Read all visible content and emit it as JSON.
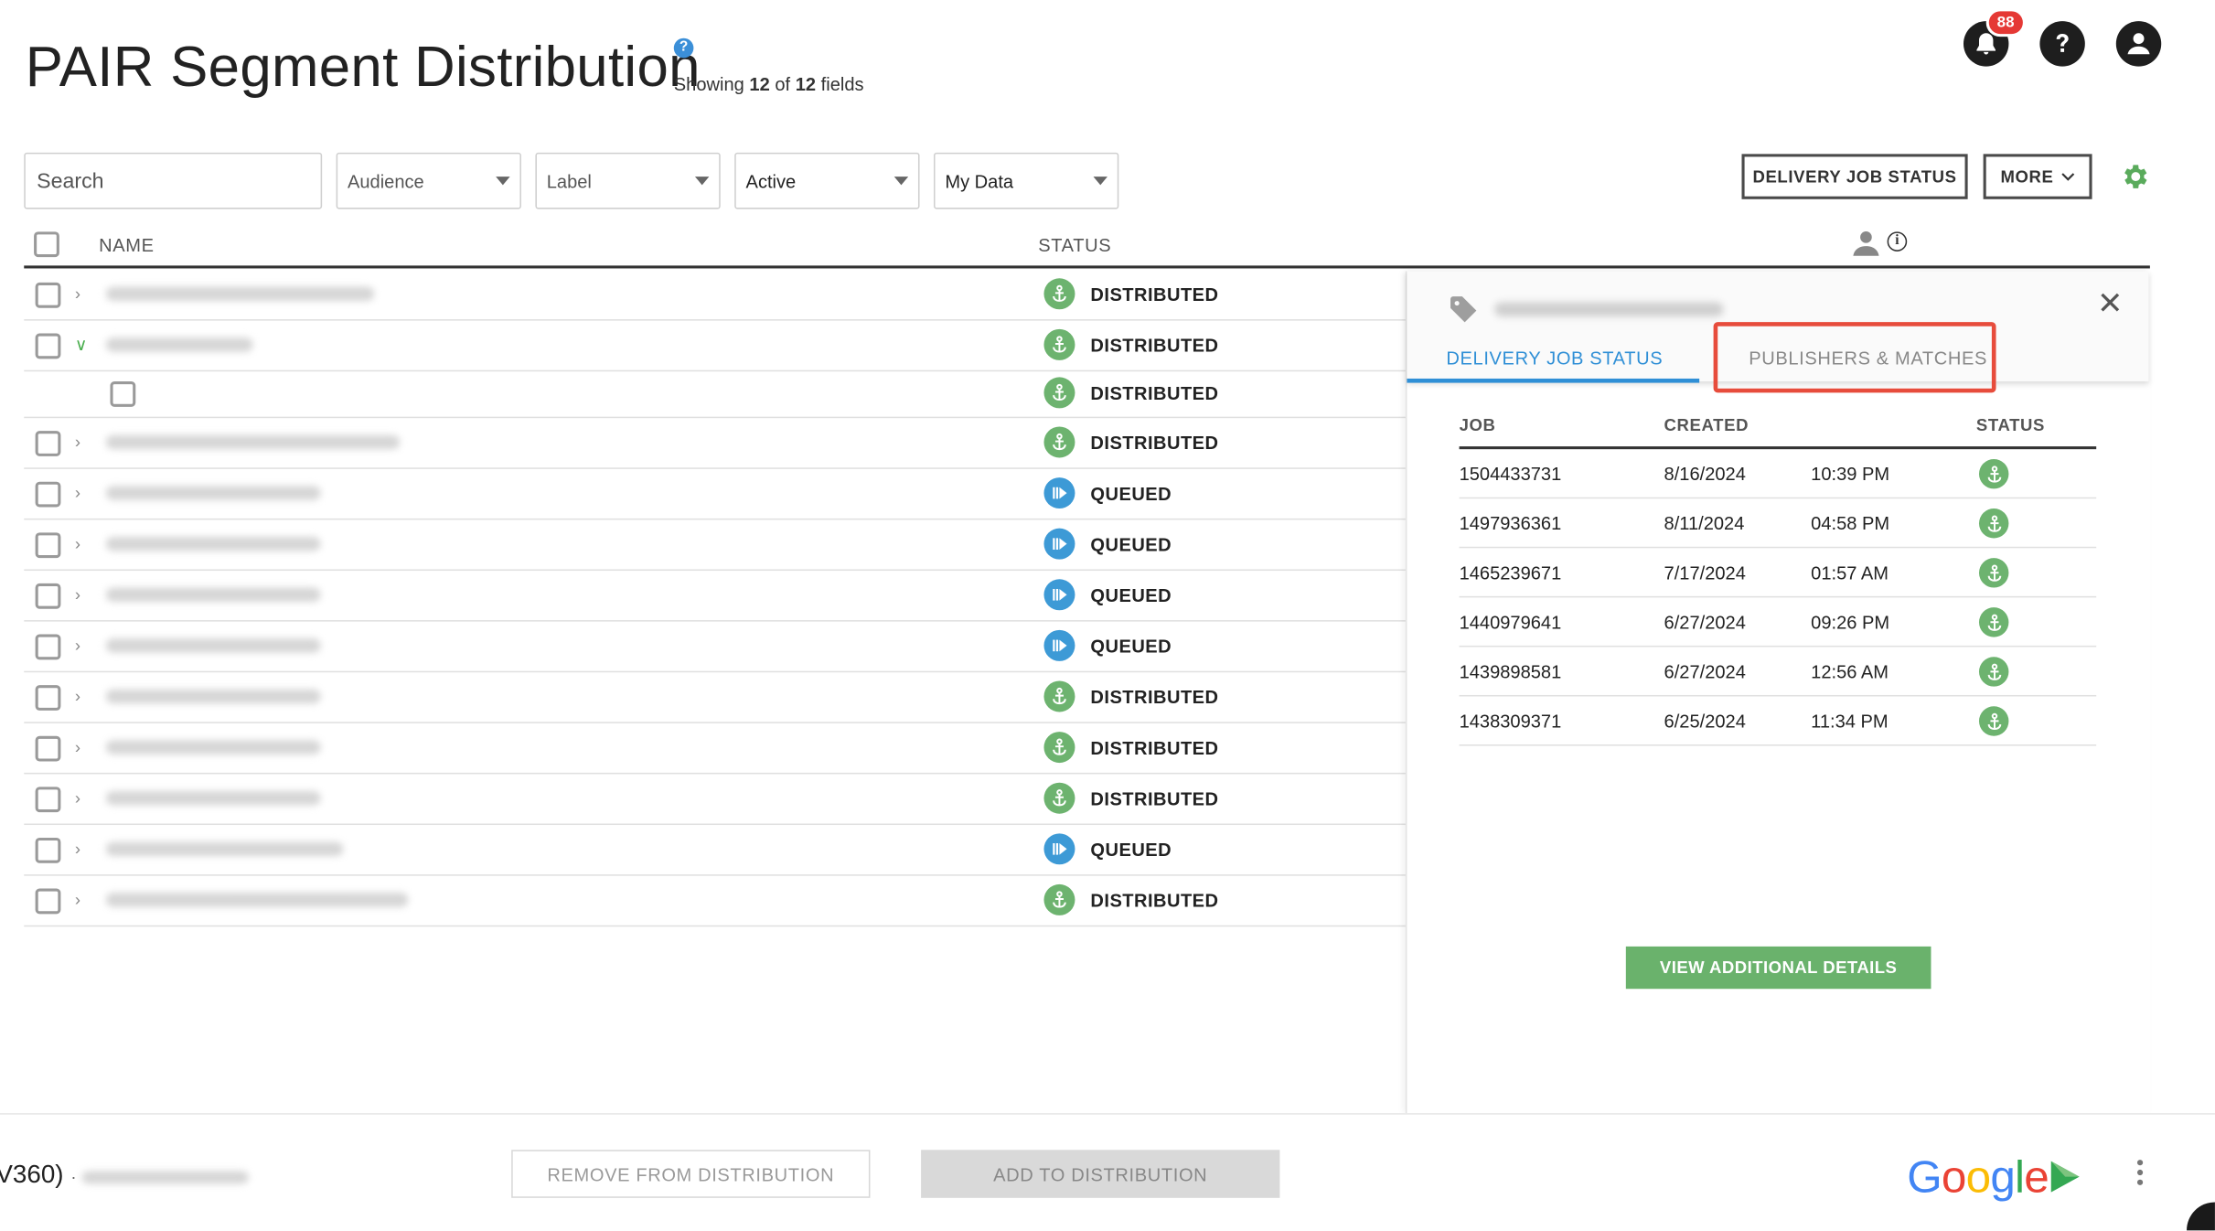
{
  "header": {
    "title": "PAIR Segment Distribution",
    "help_glyph": "?",
    "showing_prefix": "Showing",
    "showing_count": "12",
    "showing_of": "of",
    "showing_total": "12",
    "showing_suffix": "fields",
    "notification_count": "88"
  },
  "filters": {
    "search_placeholder": "Search",
    "audience": "Audience",
    "label": "Label",
    "active": "Active",
    "my_data": "My Data"
  },
  "toolbar": {
    "delivery_job_status": "DELIVERY JOB STATUS",
    "more": "MORE"
  },
  "table": {
    "col_name": "NAME",
    "col_status": "STATUS",
    "rows": [
      {
        "status": "DISTRIBUTED",
        "kind": "dist"
      },
      {
        "status": "DISTRIBUTED",
        "kind": "dist"
      },
      {
        "status": "DISTRIBUTED",
        "kind": "dist"
      },
      {
        "status": "DISTRIBUTED",
        "kind": "dist"
      },
      {
        "status": "QUEUED",
        "kind": "queued"
      },
      {
        "status": "QUEUED",
        "kind": "queued"
      },
      {
        "status": "QUEUED",
        "kind": "queued"
      },
      {
        "status": "QUEUED",
        "kind": "queued"
      },
      {
        "status": "DISTRIBUTED",
        "kind": "dist"
      },
      {
        "status": "DISTRIBUTED",
        "kind": "dist"
      },
      {
        "status": "DISTRIBUTED",
        "kind": "dist"
      },
      {
        "status": "QUEUED",
        "kind": "queued"
      },
      {
        "status": "DISTRIBUTED",
        "kind": "dist"
      }
    ]
  },
  "panel": {
    "tab_delivery": "DELIVERY JOB STATUS",
    "tab_publishers": "PUBLISHERS & MATCHES",
    "close_glyph": "✕",
    "col_job": "JOB",
    "col_created": "CREATED",
    "col_status": "STATUS",
    "jobs": [
      {
        "job": "1504433731",
        "date": "8/16/2024",
        "time": "10:39 PM"
      },
      {
        "job": "1497936361",
        "date": "8/11/2024",
        "time": "04:58 PM"
      },
      {
        "job": "1465239671",
        "date": "7/17/2024",
        "time": "01:57 AM"
      },
      {
        "job": "1440979641",
        "date": "6/27/2024",
        "time": "09:26 PM"
      },
      {
        "job": "1439898581",
        "date": "6/27/2024",
        "time": "12:56 AM"
      },
      {
        "job": "1438309371",
        "date": "6/25/2024",
        "time": "11:34 PM"
      }
    ],
    "view_details": "VIEW ADDITIONAL DETAILS"
  },
  "footer": {
    "left_text": "V360)",
    "left_sep": "·",
    "remove_button": "REMOVE FROM DISTRIBUTION",
    "add_button": "ADD TO DISTRIBUTION",
    "brand": {
      "G": "G",
      "o1": "o",
      "o2": "o",
      "g": "g",
      "l": "l",
      "e": "e"
    }
  },
  "colors": {
    "accent_blue": "#2f8fd6",
    "distributed_green": "#6db36f",
    "queued_blue": "#3d9ad6",
    "highlight_red": "#e74c3c",
    "button_green": "#6ab26c"
  },
  "icons": {
    "distributed": "distributed-status-icon",
    "queued": "queued-status-icon",
    "bell": "bell-icon",
    "help": "question-icon",
    "user": "user-icon",
    "gear": "gear-icon",
    "tag": "tag-icon",
    "close": "close-icon"
  }
}
